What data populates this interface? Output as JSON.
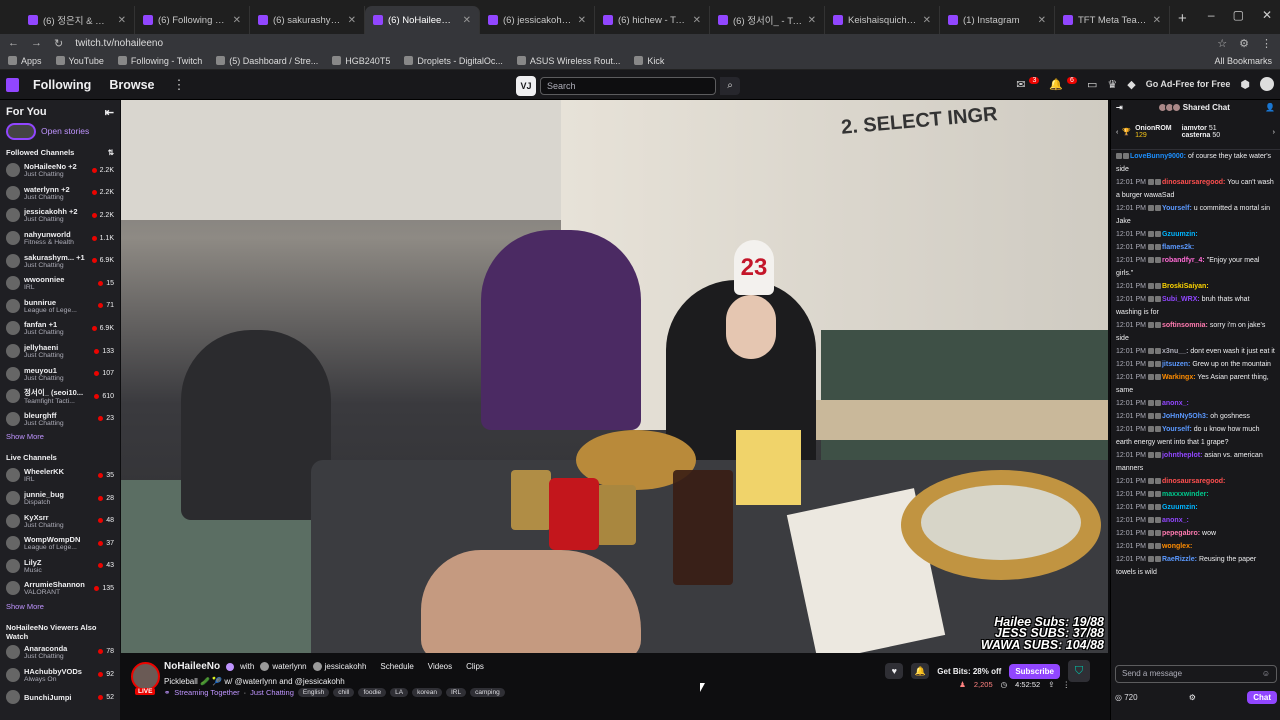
{
  "browser": {
    "tabs": [
      {
        "label": "(6) 정은지 & 서인국 - All For",
        "active": false
      },
      {
        "label": "(6) Following - Twitch",
        "active": false
      },
      {
        "label": "(6) sakurashymko - Twitch",
        "active": false
      },
      {
        "label": "(6) NoHaileeNo - Twitch",
        "active": true
      },
      {
        "label": "(6) jessicakohh - Twitch",
        "active": false
      },
      {
        "label": "(6) hichew - Twitch",
        "active": false
      },
      {
        "label": "(6) 정서이_ - Twitch",
        "active": false
      },
      {
        "label": "Keishaisquiche (@keishaisquic",
        "active": false
      },
      {
        "label": "(1) Instagram",
        "active": false
      },
      {
        "label": "TFT Meta Team Comps Tier Li",
        "active": false
      }
    ],
    "url": "twitch.tv/nohaileeno",
    "bookmarks": [
      "Apps",
      "YouTube",
      "Following - Twitch",
      "(5) Dashboard / Stre...",
      "HGB240T5",
      "Droplets - DigitalOc...",
      "ASUS Wireless Rout...",
      "Kick"
    ],
    "all_bookmarks": "All Bookmarks"
  },
  "topnav": {
    "following": "Following",
    "browse": "Browse",
    "vj": "VJ",
    "search_placeholder": "Search",
    "notif_badge_1": "3",
    "notif_badge_2": "6",
    "adfree": "Go Ad-Free for Free"
  },
  "sidebar": {
    "for_you": "For You",
    "open_stories": "Open stories",
    "followed_title": "Followed Channels",
    "followed": [
      {
        "name": "NoHaileeNo +2",
        "game": "Just Chatting",
        "viewers": "2.2K"
      },
      {
        "name": "waterlynn +2",
        "game": "Just Chatting",
        "viewers": "2.2K"
      },
      {
        "name": "jessicakohh +2",
        "game": "Just Chatting",
        "viewers": "2.2K"
      },
      {
        "name": "nahyunworld",
        "game": "Fitness & Health",
        "viewers": "1.1K"
      },
      {
        "name": "sakurashym... +1",
        "game": "Just Chatting",
        "viewers": "6.9K"
      },
      {
        "name": "wwoonniee",
        "game": "IRL",
        "viewers": "15"
      },
      {
        "name": "bunnirue",
        "game": "League of Lege...",
        "viewers": "71"
      },
      {
        "name": "fanfan +1",
        "game": "Just Chatting",
        "viewers": "6.9K"
      },
      {
        "name": "jellyhaeni",
        "game": "Just Chatting",
        "viewers": "133"
      },
      {
        "name": "meuyou1",
        "game": "Just Chatting",
        "viewers": "107"
      },
      {
        "name": "정서이_ (seoi10...",
        "game": "Teamfight Tacti...",
        "viewers": "610"
      },
      {
        "name": "bleurghff",
        "game": "Just Chatting",
        "viewers": "23"
      }
    ],
    "show_more": "Show More",
    "live_title": "Live Channels",
    "live": [
      {
        "name": "WheelerKK",
        "game": "IRL",
        "viewers": "35"
      },
      {
        "name": "junnie_bug",
        "game": "Dispatch",
        "viewers": "28"
      },
      {
        "name": "KyXsrr",
        "game": "Just Chatting",
        "viewers": "48"
      },
      {
        "name": "WompWompDN",
        "game": "League of Lege...",
        "viewers": "37"
      },
      {
        "name": "LilyZ",
        "game": "Music",
        "viewers": "43"
      },
      {
        "name": "ArrumieShannon",
        "game": "VALORANT",
        "viewers": "135"
      }
    ],
    "show_more_2": "Show More",
    "also_watch_title": "NoHaileeNo Viewers Also Watch",
    "also_watch": [
      {
        "name": "Anaraconda",
        "game": "Just Chatting",
        "viewers": "78"
      },
      {
        "name": "HAchubbyVODs",
        "game": "Always On",
        "viewers": "92"
      },
      {
        "name": "BunchiJumpi",
        "game": "",
        "viewers": "52"
      }
    ]
  },
  "video": {
    "table_number": "23",
    "sign_text": "2. SELECT INGR",
    "overlay": [
      "Hailee Subs: 19/88",
      "JESS SUBS: 37/88",
      "WAWA SUBS: 104/88"
    ]
  },
  "stream": {
    "channel": "NoHaileeNo",
    "with": "with",
    "collab1": "waterlynn",
    "collab2": "jessicakohh",
    "links": [
      "Schedule",
      "Videos",
      "Clips"
    ],
    "live": "LIVE",
    "title": "Pickleball 🥒 🎾 w/ @waterlynn and @jessicakohh",
    "streaming_together": "Streaming Together",
    "category": "Just Chatting",
    "tags": [
      "English",
      "chill",
      "foodie",
      "LA",
      "korean",
      "IRL",
      "camping"
    ],
    "bits": "Get Bits: 28% off",
    "subscribe": "Subscribe",
    "viewers": "2,205",
    "uptime": "4:52:52"
  },
  "chat": {
    "header": "Shared Chat",
    "leaders": [
      {
        "name": "OnionROM",
        "value": "129"
      },
      {
        "name": "iamvtor",
        "value": "51"
      },
      {
        "name": "casterna",
        "value": "50"
      }
    ],
    "messages": [
      {
        "time": "",
        "user": "LoveBunny9000:",
        "color": "#1e90ff",
        "text": "of course they take water's side"
      },
      {
        "time": "12:01 PM",
        "user": "dinosaursaregood:",
        "color": "#ff4f4f",
        "text": "You can't wash a burger wawaSad"
      },
      {
        "time": "12:01 PM",
        "user": "Yourself:",
        "color": "#5b99ff",
        "text": "u committed a mortal sin Jake"
      },
      {
        "time": "12:01 PM",
        "user": "Gzuumzin:",
        "color": "#00b5ff",
        "text": ""
      },
      {
        "time": "12:01 PM",
        "user": "flames2k:",
        "color": "#5b99ff",
        "text": ""
      },
      {
        "time": "12:01 PM",
        "user": "robandfyr_4:",
        "color": "#ff6bd5",
        "text": "\"Enjoy your meal girls.\""
      },
      {
        "time": "12:01 PM",
        "user": "BroskiSaiyan:",
        "color": "#ffd600",
        "text": ""
      },
      {
        "time": "12:01 PM",
        "user": "Subi_WRX:",
        "color": "#9146ff",
        "text": "bruh thats what washing is for"
      },
      {
        "time": "12:01 PM",
        "user": "softinsomnia:",
        "color": "#ff7ab0",
        "text": "sorry i'm on jake's side"
      },
      {
        "time": "12:01 PM",
        "user": "x3nu__:",
        "color": "#adadb8",
        "text": "dont even wash it just eat it"
      },
      {
        "time": "12:01 PM",
        "user": "jitsuzen:",
        "color": "#5b99ff",
        "text": "Grew up on the mountain"
      },
      {
        "time": "12:01 PM",
        "user": "Warkingx:",
        "color": "#ff8c00",
        "text": "Yes Asian parent thing, same"
      },
      {
        "time": "12:01 PM",
        "user": "anonx_:",
        "color": "#9146ff",
        "text": ""
      },
      {
        "time": "12:01 PM",
        "user": "JoHnNy5Oh3:",
        "color": "#5b99ff",
        "text": "oh goshness"
      },
      {
        "time": "12:01 PM",
        "user": "Yourself:",
        "color": "#5b99ff",
        "text": "do u know how much earth energy went into that 1 grape?"
      },
      {
        "time": "12:01 PM",
        "user": "johntheplot:",
        "color": "#9146ff",
        "text": "asian vs. american manners"
      },
      {
        "time": "12:01 PM",
        "user": "dinosaursaregood:",
        "color": "#ff4f4f",
        "text": ""
      },
      {
        "time": "12:01 PM",
        "user": "maxxxwinder:",
        "color": "#00c78c",
        "text": ""
      },
      {
        "time": "12:01 PM",
        "user": "Gzuumzin:",
        "color": "#00b5ff",
        "text": ""
      },
      {
        "time": "12:01 PM",
        "user": "anonx_:",
        "color": "#9146ff",
        "text": ""
      },
      {
        "time": "12:01 PM",
        "user": "pepegabro:",
        "color": "#ff7ab0",
        "text": "wow"
      },
      {
        "time": "12:01 PM",
        "user": "wonglex:",
        "color": "#ff8c00",
        "text": ""
      },
      {
        "time": "12:01 PM",
        "user": "RaeRizzle:",
        "color": "#5b99ff",
        "text": "Reusing the paper towels is wild"
      }
    ],
    "input_placeholder": "Send a message",
    "points": "720",
    "chat_button": "Chat"
  }
}
